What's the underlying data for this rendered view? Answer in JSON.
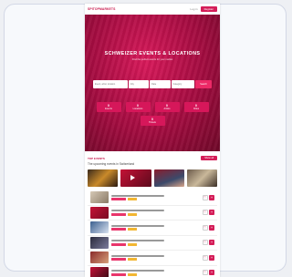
{
  "header": {
    "logo": "SPITOPMARKETS",
    "login_label": "Log in",
    "register_label": "Register"
  },
  "hero": {
    "title": "SCHWEIZER EVENTS & LOCATIONS",
    "subtitle": "Find the perfect events for your market",
    "search": {
      "field1_placeholder": "Event, artist, location",
      "field2_placeholder": "City",
      "field3_placeholder": "Date",
      "field4_placeholder": "Category",
      "button_label": "Search"
    },
    "stats": [
      {
        "value": "0",
        "label": "Events"
      },
      {
        "value": "0",
        "label": "Locations"
      },
      {
        "value": "0",
        "label": "Artists"
      },
      {
        "value": "0",
        "label": "Cities"
      },
      {
        "value": "0",
        "label": "Tickets"
      }
    ]
  },
  "section": {
    "title": "TOP EVENTS",
    "subtitle": "The upcoming events in Switzerland",
    "more_button": "Show all"
  },
  "colors": {
    "brand": "#d41d58",
    "hero_dark": "#6e0828",
    "tag_yellow": "#f2b632"
  },
  "list_rows": 6
}
